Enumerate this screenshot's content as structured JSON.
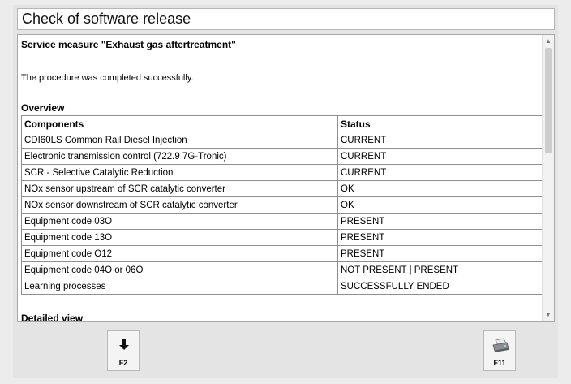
{
  "window": {
    "title": "Check of software release"
  },
  "content": {
    "heading": "Service measure \"Exhaust gas aftertreatment\"",
    "message": "The procedure was completed successfully.",
    "overview_label": "Overview",
    "table": {
      "headers": [
        "Components",
        "Status"
      ],
      "rows": [
        [
          "CDI60LS Common Rail Diesel Injection",
          "CURRENT"
        ],
        [
          "Electronic transmission control (722.9 7G-Tronic)",
          "CURRENT"
        ],
        [
          "SCR - Selective Catalytic Reduction",
          "CURRENT"
        ],
        [
          "NOx sensor upstream of SCR catalytic converter",
          "OK"
        ],
        [
          "NOx sensor downstream of SCR catalytic converter",
          "OK"
        ],
        [
          "Equipment code 03O",
          "PRESENT"
        ],
        [
          "Equipment code 13O",
          "PRESENT"
        ],
        [
          "Equipment code O12",
          "PRESENT"
        ],
        [
          "Equipment code 04O or 06O",
          "NOT PRESENT | PRESENT"
        ],
        [
          "Learning processes",
          "SUCCESSFULLY ENDED"
        ]
      ]
    },
    "detailed_label": "Detailed view"
  },
  "buttons": {
    "f2": {
      "label": "F2",
      "icon": "arrow-down-icon"
    },
    "f11": {
      "label": "F11",
      "icon": "printer-icon"
    }
  }
}
